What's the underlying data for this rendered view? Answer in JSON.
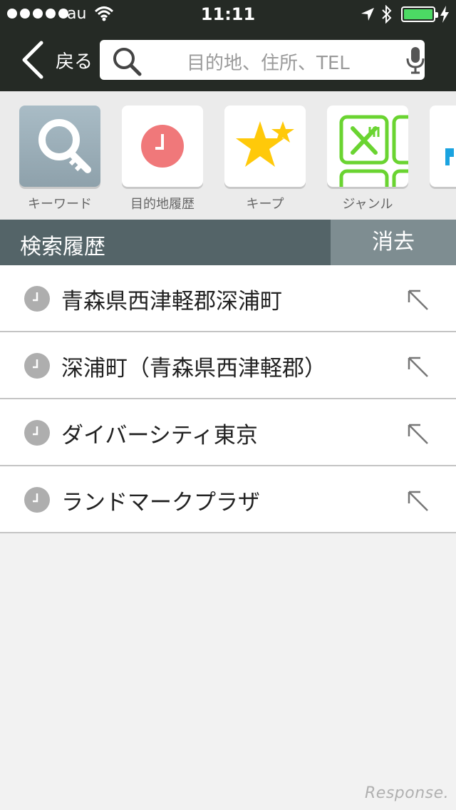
{
  "status_bar": {
    "carrier": "au",
    "time": "11:11"
  },
  "nav": {
    "back_label": "戻る",
    "search_placeholder": "目的地、住所、TEL"
  },
  "categories": [
    {
      "label": "キーワード",
      "icon": "magnifier-key-icon"
    },
    {
      "label": "目的地履歴",
      "icon": "clock-icon"
    },
    {
      "label": "キープ",
      "icon": "stars-icon"
    },
    {
      "label": "ジャンル",
      "icon": "genre-grid-icon"
    },
    {
      "label": "",
      "icon": "more-category-icon"
    }
  ],
  "history": {
    "title": "検索履歴",
    "clear_label": "消去",
    "items": [
      {
        "text": "青森県西津軽郡深浦町"
      },
      {
        "text": "深浦町（青森県西津軽郡）"
      },
      {
        "text": "ダイバーシティ東京"
      },
      {
        "text": "ランドマークプラザ"
      }
    ]
  },
  "watermark": "Response.",
  "colors": {
    "topbar": "#252a25",
    "section_header": "#546468",
    "clear_button": "#7e8d91",
    "battery": "#4cd964",
    "clock_red": "#f0787a",
    "star_yellow": "#ffc90a",
    "genre_green": "#6ad431"
  }
}
